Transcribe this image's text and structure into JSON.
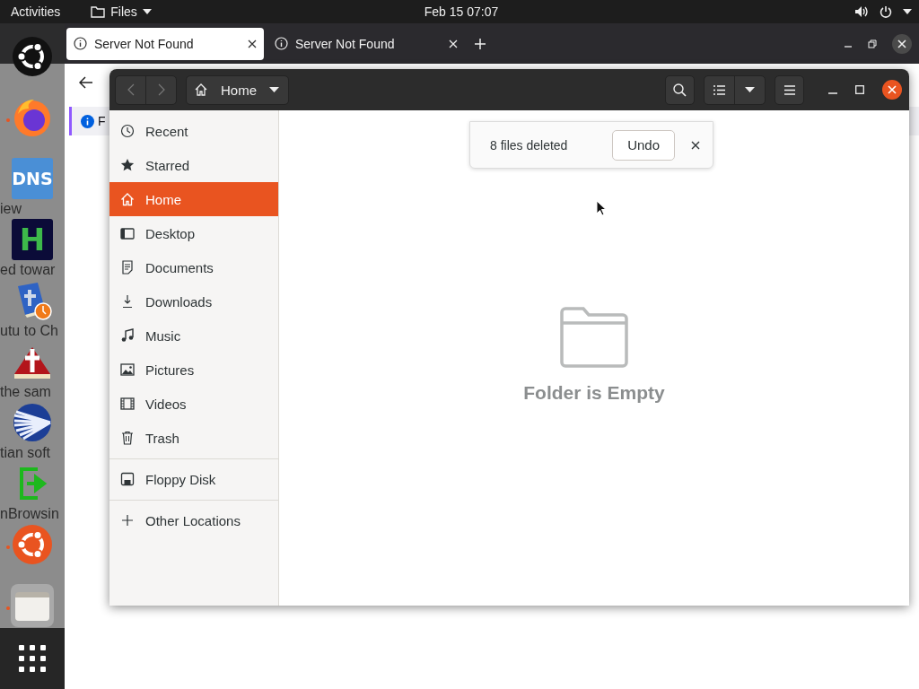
{
  "top_bar": {
    "activities": "Activities",
    "app_menu": "Files",
    "clock": "Feb 15  07:07"
  },
  "dock": {
    "items": [
      {
        "kind": "ring-dark",
        "running": false,
        "selected": false
      },
      {
        "kind": "flame-globe",
        "running": true,
        "selected": false
      },
      {
        "kind": "tile-blue",
        "label": "DNS",
        "running": false,
        "selected": false
      },
      {
        "kind": "tile-navy",
        "label": "H",
        "running": false,
        "selected": false
      },
      {
        "kind": "book-clock",
        "running": false,
        "selected": false
      },
      {
        "kind": "book-cross",
        "running": false,
        "selected": false
      },
      {
        "kind": "sphere",
        "running": false,
        "selected": false
      },
      {
        "kind": "green-arrow",
        "running": false,
        "selected": false
      },
      {
        "kind": "ring-orange",
        "running": true,
        "selected": false
      },
      {
        "kind": "folder",
        "running": true,
        "selected": true
      }
    ]
  },
  "browser": {
    "tabs": [
      {
        "title": "Server Not Found",
        "selected": true
      },
      {
        "title": "Server Not Found",
        "selected": false
      }
    ],
    "infobar": "F",
    "page": {
      "lines": [
        "iew",
        "ed towar",
        "utu to Ch",
        "the sam",
        "tian soft",
        "nBrowsin"
      ]
    }
  },
  "file_manager": {
    "path": "Home",
    "sidebar": {
      "sections": [
        [
          {
            "label": "Recent",
            "kind": "recent",
            "selected": false
          },
          {
            "label": "Starred",
            "kind": "star",
            "selected": false
          },
          {
            "label": "Home",
            "kind": "home",
            "selected": true
          },
          {
            "label": "Desktop",
            "kind": "desktop",
            "selected": false
          },
          {
            "label": "Documents",
            "kind": "document",
            "selected": false
          },
          {
            "label": "Downloads",
            "kind": "download",
            "selected": false
          },
          {
            "label": "Music",
            "kind": "music",
            "selected": false
          },
          {
            "label": "Pictures",
            "kind": "picture",
            "selected": false
          },
          {
            "label": "Videos",
            "kind": "film",
            "selected": false
          },
          {
            "label": "Trash",
            "kind": "trash",
            "selected": false
          }
        ],
        [
          {
            "label": "Floppy Disk",
            "kind": "floppy",
            "selected": false
          }
        ],
        [
          {
            "label": "Other Locations",
            "kind": "plus",
            "selected": false
          }
        ]
      ]
    },
    "notification": {
      "message": "8 files deleted",
      "action": "Undo"
    },
    "empty_message": "Folder is Empty"
  }
}
